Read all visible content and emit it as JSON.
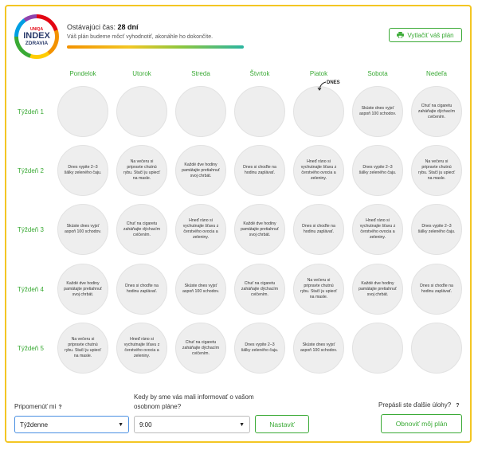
{
  "logo": {
    "brand": "UNIQA",
    "main": "INDEX",
    "sub": "ZDRAVIA"
  },
  "header": {
    "remaining_label": "Ostávajúci čas:",
    "remaining_value": "28 dní",
    "info": "Váš plán budeme môcť vyhodnotiť, akonáhle ho dokončíte.",
    "print_label": "Vytlačiť váš plán"
  },
  "days": [
    "Pondelok",
    "Utorok",
    "Streda",
    "Štvrtok",
    "Piatok",
    "Sobota",
    "Nedeľa"
  ],
  "today_label": "DNES",
  "weeks": [
    {
      "label": "Týždeň 1",
      "cells": [
        "",
        "",
        "",
        "",
        "",
        "Skúste dnes vyjsť aspoň 100 schodov.",
        "Chuť na cigaretu zaháňajte dýchacím cvičením."
      ]
    },
    {
      "label": "Týždeň 2",
      "cells": [
        "Dnes vypite 2–3 šálky zeleného čaju.",
        "Na večeru si pripravte chutnú rybu. Stačí ju upiecť na masle.",
        "Každé dve hodiny pamätajte pretiahnuť svoj chrbát.",
        "Dnes si choďte na hodinu zaplávať.",
        "Hneď ráno si vychutnajte šťavu z čerstvého ovocia a zeleniny.",
        "Dnes vypite 2–3 šálky zeleného čaju.",
        "Na večeru si pripravte chutnú rybu. Stačí ju upiecť na masle."
      ]
    },
    {
      "label": "Týždeň 3",
      "cells": [
        "Skúste dnes vyjsť aspoň 100 schodov.",
        "Chuť na cigaretu zaháňajte dýchacím cvičením.",
        "Hneď ráno si vychutnajte šťavu z čerstvého ovocia a zeleniny.",
        "Každé dve hodiny pamätajte pretiahnuť svoj chrbát.",
        "Dnes si choďte na hodinu zaplávať.",
        "Hneď ráno si vychutnajte šťavu z čerstvého ovocia a zeleniny.",
        "Dnes vypite 2–3 šálky zeleného čaju."
      ]
    },
    {
      "label": "Týždeň 4",
      "cells": [
        "Každé dve hodiny pamätajte pretiahnuť svoj chrbát.",
        "Dnes si choďte na hodinu zaplávať.",
        "Skúste dnes vyjsť aspoň 100 schodov.",
        "Chuť na cigaretu zaháňajte dýchacím cvičením.",
        "Na večeru si pripravte chutnú rybu. Stačí ju upiecť na masle.",
        "Každé dve hodiny pamätajte pretiahnuť svoj chrbát.",
        "Dnes si choďte na hodinu zaplávať."
      ]
    },
    {
      "label": "Týždeň 5",
      "cells": [
        "Na večeru si pripravte chutnú rybu. Stačí ju upiecť na masle.",
        "Hneď ráno si vychutnajte šťavu z čerstvého ovocia a zeleniny.",
        "Chuť na cigaretu zaháňajte dýchacím cvičením.",
        "Dnes vypite 2–3 šálky zeleného čaju.",
        "Skúste dnes vyjsť aspoň 100 schodov.",
        "",
        ""
      ]
    }
  ],
  "footer": {
    "remind_label": "Pripomenúť mi",
    "remind_help": "?",
    "remind_value": "Týždenne",
    "when_label": "Kedy by sme vás mali informovať o vašom osobnom pláne?",
    "time_value": "9:00",
    "set_label": "Nastaviť",
    "missed_label": "Prepásli ste ďalšie úlohy?",
    "missed_help": "?",
    "refresh_label": "Obnoviť môj plán"
  },
  "colors": {
    "accent": "#3aaa35",
    "frame": "#f3c623",
    "cell": "#eeeeee",
    "select_active": "#4a90e2"
  }
}
